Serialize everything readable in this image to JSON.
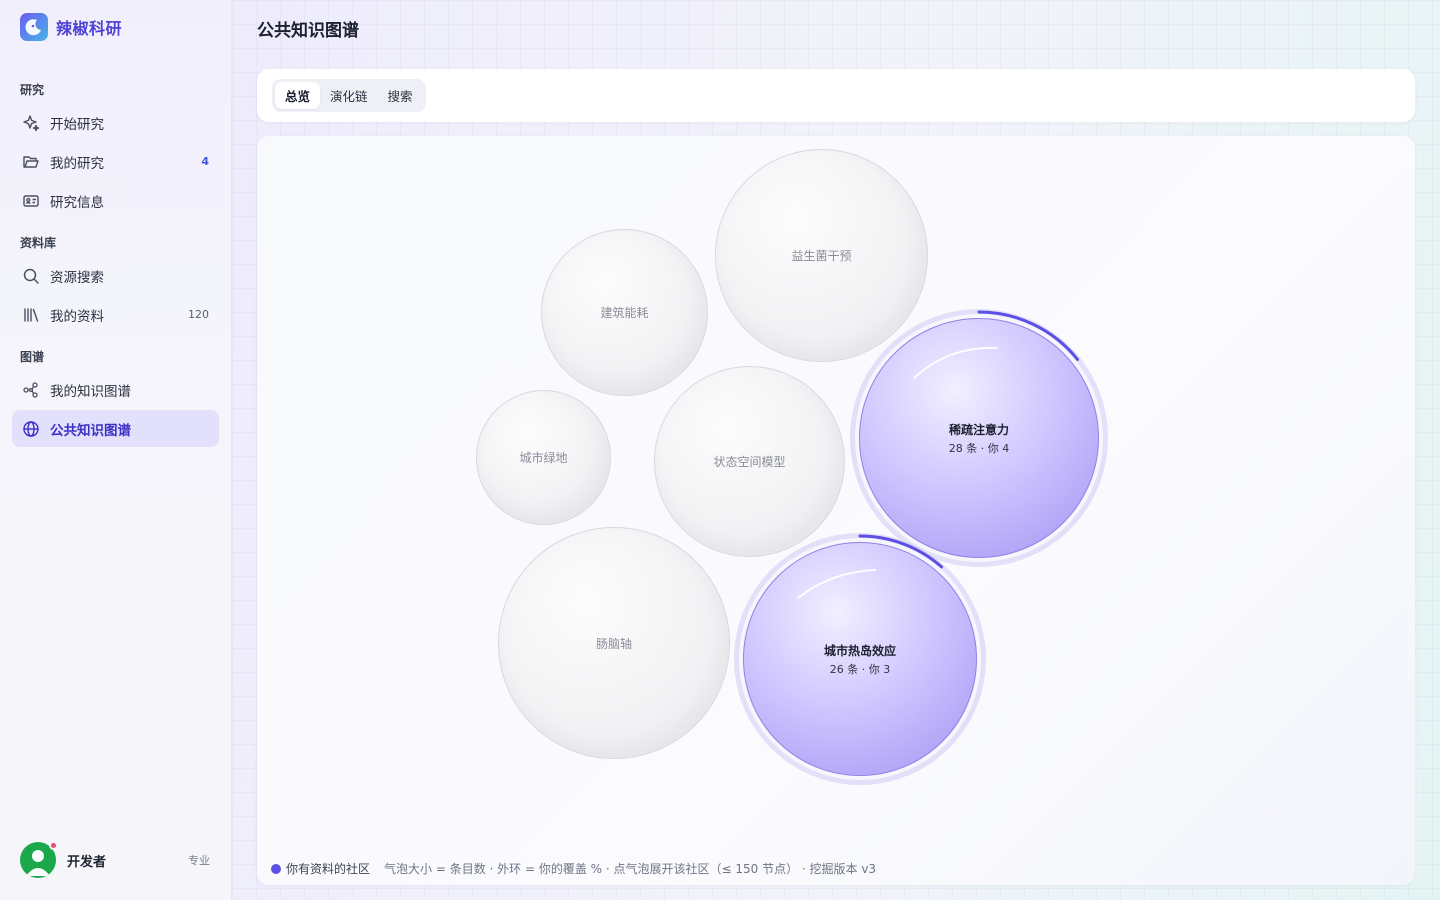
{
  "brand": {
    "name": "辣椒科研"
  },
  "sidebar": {
    "sections": [
      {
        "label": "研究"
      },
      {
        "label": "资料库"
      },
      {
        "label": "图谱"
      }
    ],
    "items": [
      {
        "label": "开始研究",
        "icon": "sparkles-icon",
        "badge": ""
      },
      {
        "label": "我的研究",
        "icon": "folder-open-icon",
        "badge": "4"
      },
      {
        "label": "研究信息",
        "icon": "id-card-icon",
        "badge": ""
      },
      {
        "label": "资源搜索",
        "icon": "search-icon",
        "badge": ""
      },
      {
        "label": "我的资料",
        "icon": "library-icon",
        "badge": "120"
      },
      {
        "label": "我的知识图谱",
        "icon": "graph-nodes-icon",
        "badge": ""
      },
      {
        "label": "公共知识图谱",
        "icon": "globe-icon",
        "badge": "",
        "active": true
      }
    ]
  },
  "user": {
    "name": "开发者",
    "plan": "专业"
  },
  "page": {
    "title": "公共知识图谱"
  },
  "tabs": [
    {
      "label": "总览",
      "active": true
    },
    {
      "label": "演化链",
      "active": false
    },
    {
      "label": "搜索",
      "active": false
    }
  ],
  "bubbles": [
    {
      "label": "益生菌干预",
      "highlighted": false
    },
    {
      "label": "建筑能耗",
      "highlighted": false
    },
    {
      "label": "城市绿地",
      "highlighted": false
    },
    {
      "label": "状态空间模型",
      "highlighted": false
    },
    {
      "label": "稀疏注意力",
      "highlighted": true,
      "count": 28,
      "mine": 4,
      "sub": "28 条 · 你 4"
    },
    {
      "label": "肠脑轴",
      "highlighted": false
    },
    {
      "label": "城市热岛效应",
      "highlighted": true,
      "count": 26,
      "mine": 3,
      "sub": "26 条 · 你 3"
    }
  ],
  "legend": {
    "label": "你有资料的社区",
    "note": "气泡大小 = 条目数 · 外环 = 你的覆盖 % · 点气泡展开该社区（≤ 150 节点） · 挖掘版本 v3"
  },
  "colors": {
    "accent": "#5b4fe6",
    "bubble_grey": "#f1f1f4",
    "bubble_purple": "#c9c0fb"
  }
}
